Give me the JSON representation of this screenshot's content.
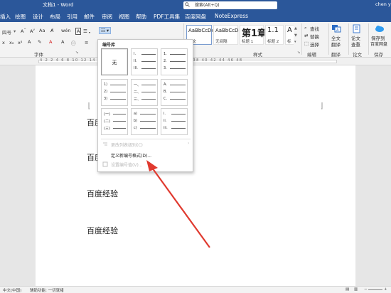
{
  "titlebar": {
    "doc_title": "文档1 - Word",
    "search": "搜索(Alt+Q)",
    "user": "chen y"
  },
  "tabs": [
    "插入",
    "绘图",
    "设计",
    "布局",
    "引用",
    "邮件",
    "审阅",
    "视图",
    "帮助",
    "PDF工具集",
    "百度网盘",
    "NoteExpress"
  ],
  "ribbon": {
    "font_size": "四号",
    "group_font": "字体",
    "group_styles": "样式",
    "group_edit": "编辑",
    "group_translate": "翻译",
    "group_thesis": "论文",
    "group_baidu": "保存",
    "styles": [
      {
        "preview": "AaBbCcDd",
        "name": "正文"
      },
      {
        "preview": "AaBbCcDd",
        "name": "无间隔"
      },
      {
        "preview": "第1章",
        "name": "标题 1"
      },
      {
        "preview": "1.1",
        "name": "标题 2"
      },
      {
        "preview": "A",
        "name": "标"
      }
    ],
    "edit_find": "查找",
    "edit_replace": "替换",
    "edit_select": "选择",
    "fulltext_label_1": "全文",
    "fulltext_label_2": "翻译",
    "thesis_label_1": "论文",
    "thesis_label_2": "查重",
    "baidu_label_1": "保存到",
    "baidu_label_2": "百度网盘"
  },
  "ruler": {
    "numbers": "4  2    2  4  6  8  10  12  14  16  18  20  22  24  26  28  30  32  34  36  38  40  42  44  46  48"
  },
  "document": {
    "paragraphs": [
      "百度经验",
      "百度经验",
      "百度经验",
      "百度经验"
    ]
  },
  "dropdown": {
    "title": "编号库",
    "none_label": "无",
    "tiles": [
      [
        "1.",
        "2.",
        "3."
      ],
      [
        "I.",
        "II.",
        "III."
      ],
      [
        "1)",
        "2)",
        "3)"
      ],
      [
        "一、",
        "二、",
        "三、"
      ],
      [
        "A.",
        "B.",
        "C."
      ],
      [
        "(一)",
        "(二)",
        "(三)"
      ],
      [
        "a)",
        "b)",
        "c)"
      ],
      [
        "i.",
        "ii.",
        "iii."
      ]
    ],
    "change_level": "更改列表级别(C)",
    "define_new": "定义新编号格式(D)...",
    "set_value": "设置编号值(V)..."
  },
  "statusbar": {
    "language": "中文(中国)",
    "accessibility": "辅助功能: 一切就绪",
    "view": "",
    "zoom": ""
  },
  "colors": {
    "titlebar": "#2b579a",
    "arrow": "#e03a2f"
  }
}
